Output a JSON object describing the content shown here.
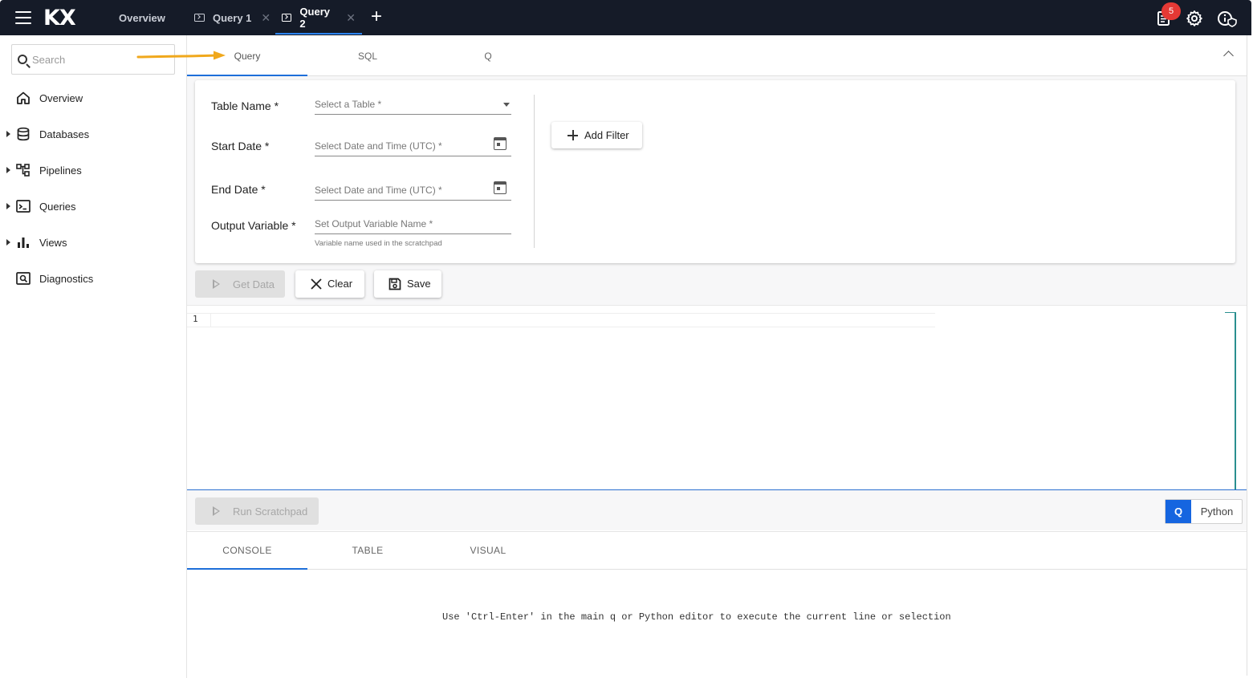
{
  "topbar": {
    "logo": "KX",
    "tabs": [
      {
        "label": "Overview"
      },
      {
        "label": "Query 1",
        "close": "✕"
      },
      {
        "label": "Query 2",
        "close": "✕"
      }
    ],
    "add_tab": "+",
    "notification_count": "5",
    "icons": [
      "menu-icon",
      "document-icon",
      "gear-icon",
      "info-shield-icon"
    ]
  },
  "sidebar": {
    "search_placeholder": "Search",
    "items": [
      {
        "label": "Overview",
        "icon": "home-icon"
      },
      {
        "label": "Databases",
        "icon": "database-icon"
      },
      {
        "label": "Pipelines",
        "icon": "pipelines-icon"
      },
      {
        "label": "Queries",
        "icon": "terminal-icon"
      },
      {
        "label": "Views",
        "icon": "bar-chart-icon"
      },
      {
        "label": "Diagnostics",
        "icon": "diagnostics-icon"
      }
    ]
  },
  "query_tabs": [
    {
      "label": "Query"
    },
    {
      "label": "SQL"
    },
    {
      "label": "Q"
    }
  ],
  "form": {
    "table_name_label": "Table Name *",
    "table_name_placeholder": "Select a Table *",
    "start_date_label": "Start Date *",
    "start_date_placeholder": "Select Date and Time (UTC) *",
    "end_date_label": "End Date *",
    "end_date_placeholder": "Select Date and Time (UTC) *",
    "output_variable_label": "Output Variable *",
    "output_variable_placeholder": "Set Output Variable Name *",
    "output_variable_hint": "Variable name used in the scratchpad",
    "add_filter_label": "Add Filter"
  },
  "actions": {
    "get_data": "Get Data",
    "clear": "Clear",
    "save": "Save"
  },
  "editor": {
    "line_number": "1"
  },
  "scratchpad": {
    "run_label": "Run Scratchpad",
    "lang_q": "Q",
    "lang_python": "Python"
  },
  "result_tabs": [
    {
      "label": "CONSOLE"
    },
    {
      "label": "TABLE"
    },
    {
      "label": "VISUAL"
    }
  ],
  "console_message": "Use 'Ctrl-Enter' in the main q or Python editor to execute the current line or selection",
  "colors": {
    "topbar_bg": "#151b28",
    "accent": "#1e6fd9",
    "badge": "#e53935",
    "annotation_arrow": "#f0a81c"
  }
}
